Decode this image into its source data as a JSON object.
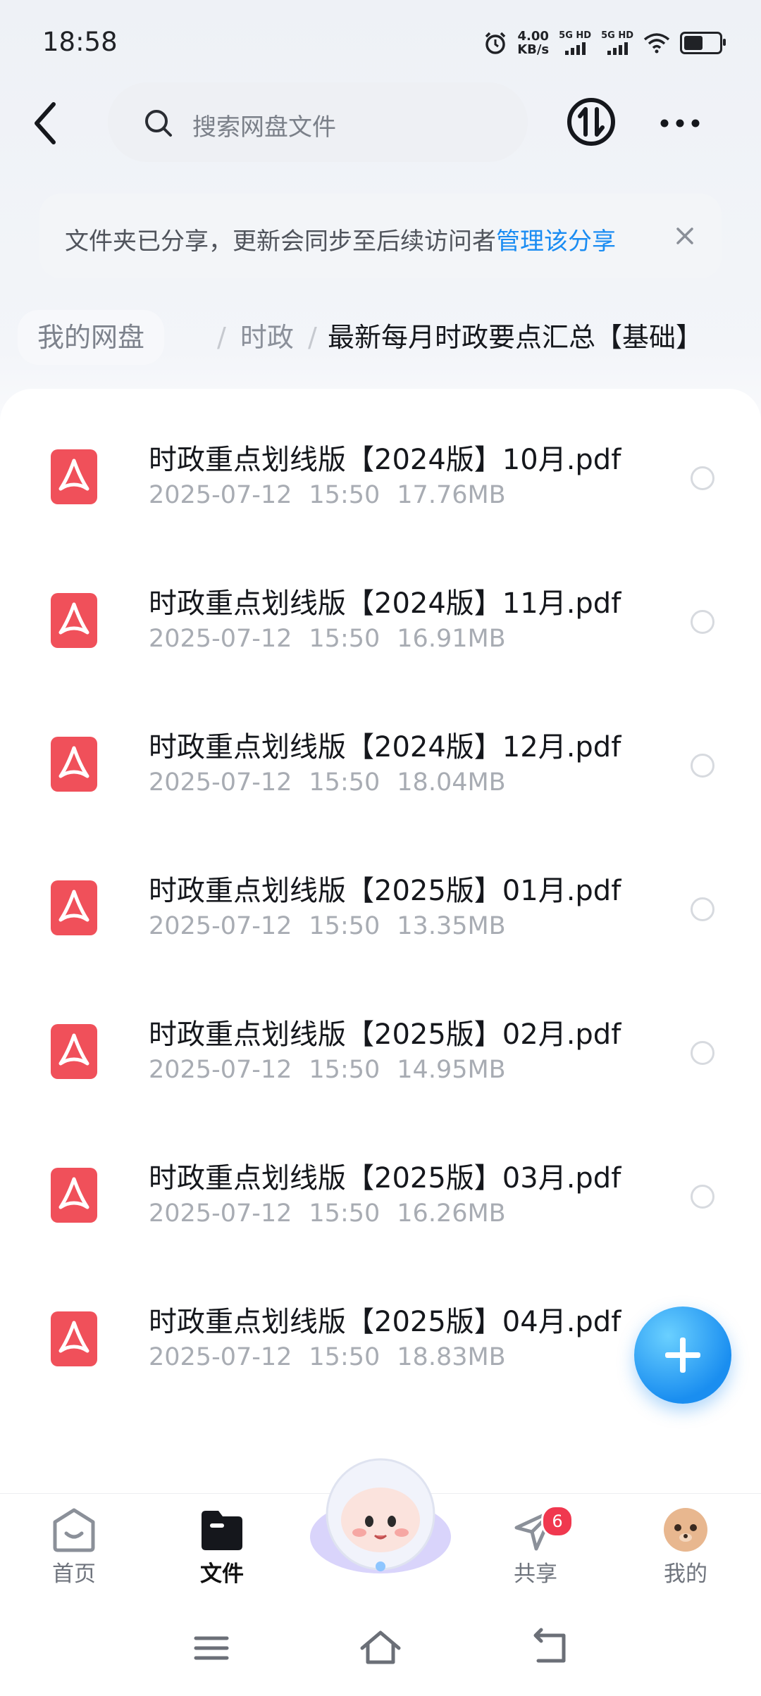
{
  "status_bar": {
    "time": "18:58",
    "speed_value": "4.00",
    "speed_unit": "KB/s",
    "network1": "5G HD",
    "network2": "5G HD"
  },
  "header": {
    "search_placeholder": "搜索网盘文件"
  },
  "banner": {
    "message": "文件夹已分享，更新会同步至后续访问者",
    "link_label": "管理该分享"
  },
  "breadcrumb": {
    "root": "我的网盘",
    "sep": "/",
    "middle": "时政",
    "current": "最新每月时政要点汇总【基础】"
  },
  "files": [
    {
      "name": "时政重点划线版【2024版】10月.pdf",
      "date": "2025-07-12",
      "time": "15:50",
      "size": "17.76MB"
    },
    {
      "name": "时政重点划线版【2024版】11月.pdf",
      "date": "2025-07-12",
      "time": "15:50",
      "size": "16.91MB"
    },
    {
      "name": "时政重点划线版【2024版】12月.pdf",
      "date": "2025-07-12",
      "time": "15:50",
      "size": "18.04MB"
    },
    {
      "name": "时政重点划线版【2025版】01月.pdf",
      "date": "2025-07-12",
      "time": "15:50",
      "size": "13.35MB"
    },
    {
      "name": "时政重点划线版【2025版】02月.pdf",
      "date": "2025-07-12",
      "time": "15:50",
      "size": "14.95MB"
    },
    {
      "name": "时政重点划线版【2025版】03月.pdf",
      "date": "2025-07-12",
      "time": "15:50",
      "size": "16.26MB"
    },
    {
      "name": "时政重点划线版【2025版】04月.pdf",
      "date": "2025-07-12",
      "time": "15:50",
      "size": "18.83MB"
    }
  ],
  "tabbar": {
    "home": "首页",
    "files": "文件",
    "share": "共享",
    "share_badge": "6",
    "mine": "我的"
  },
  "colors": {
    "accent": "#1a8cf2",
    "pdf_red": "#f0505a",
    "badge": "#f0384f"
  }
}
